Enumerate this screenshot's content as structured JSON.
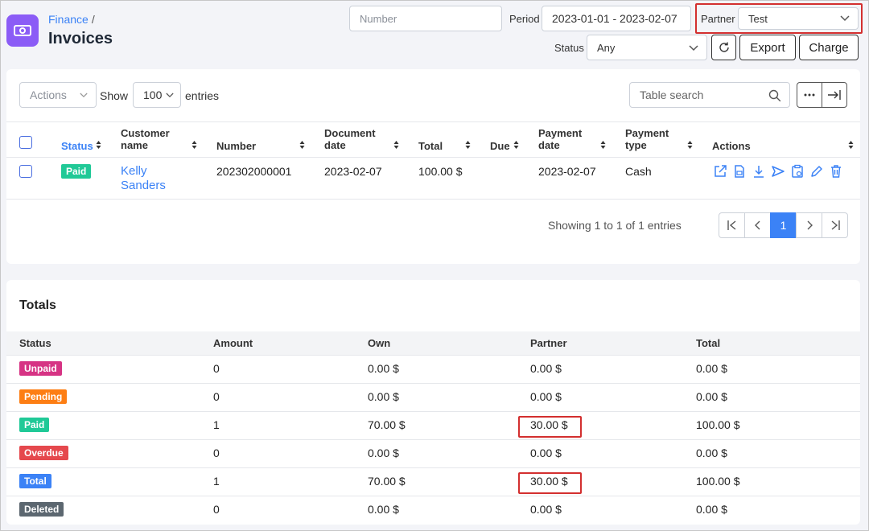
{
  "header": {
    "breadcrumb": "Finance",
    "breadcrumb_sep": "/",
    "title": "Invoices",
    "number_placeholder": "Number",
    "period_label": "Period",
    "period_value": "2023-01-01 - 2023-02-07",
    "partner_label": "Partner",
    "partner_value": "Test",
    "status_label": "Status",
    "status_value": "Any",
    "export_label": "Export",
    "charge_label": "Charge"
  },
  "toolbar": {
    "actions_label": "Actions",
    "show_label": "Show",
    "entries_value": "100",
    "entries_label": "entries",
    "search_placeholder": "Table search"
  },
  "table": {
    "headers": {
      "status": "Status",
      "customer_name": "Customer name",
      "number": "Number",
      "document_date": "Document date",
      "total": "Total",
      "due": "Due",
      "payment_date": "Payment date",
      "payment_type": "Payment type",
      "actions": "Actions"
    },
    "rows": [
      {
        "status": "Paid",
        "customer_name": "Kelly Sanders",
        "number": "202302000001",
        "document_date": "2023-02-07",
        "total": "100.00 $",
        "due": "",
        "payment_date": "2023-02-07",
        "payment_type": "Cash"
      }
    ],
    "info": "Showing 1 to 1 of 1 entries",
    "current_page": "1"
  },
  "totals": {
    "title": "Totals",
    "headers": {
      "status": "Status",
      "amount": "Amount",
      "own": "Own",
      "partner": "Partner",
      "total": "Total"
    },
    "rows": [
      {
        "status": "Unpaid",
        "color": "#d63384",
        "amount": "0",
        "own": "0.00 $",
        "partner": "0.00 $",
        "total": "0.00 $"
      },
      {
        "status": "Pending",
        "color": "#fd7e14",
        "amount": "0",
        "own": "0.00 $",
        "partner": "0.00 $",
        "total": "0.00 $"
      },
      {
        "status": "Paid",
        "color": "#20c997",
        "amount": "1",
        "own": "70.00 $",
        "partner": "30.00 $",
        "total": "100.00 $"
      },
      {
        "status": "Overdue",
        "color": "#e5484d",
        "amount": "0",
        "own": "0.00 $",
        "partner": "0.00 $",
        "total": "0.00 $"
      },
      {
        "status": "Total",
        "color": "#3b82f6",
        "amount": "1",
        "own": "70.00 $",
        "partner": "30.00 $",
        "total": "100.00 $"
      },
      {
        "status": "Deleted",
        "color": "#5c6770",
        "amount": "0",
        "own": "0.00 $",
        "partner": "0.00 $",
        "total": "0.00 $"
      }
    ]
  },
  "colors": {
    "accent": "#3b82f6",
    "brand": "#8b5cf6",
    "paid": "#20c997",
    "highlight": "#d32f2f"
  }
}
